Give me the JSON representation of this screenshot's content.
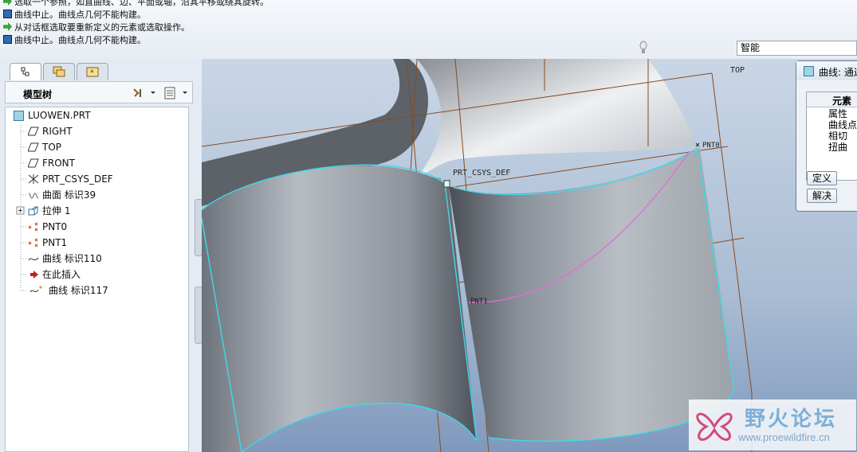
{
  "messages": [
    {
      "icon": "green-arrow-icon",
      "text": "选取一个参照，如直曲线、边、平面或轴，沿其平移或绕其旋转。"
    },
    {
      "icon": "warning-icon",
      "text": "曲线中止。曲线点几何不能构建。"
    },
    {
      "icon": "green-arrow-icon",
      "text": "从对话框选取要重新定义的元素或选取操作。"
    },
    {
      "icon": "warning-icon",
      "text": "曲线中止。曲线点几何不能构建。"
    }
  ],
  "filter": {
    "value": "智能"
  },
  "model_tree": {
    "title": "模型树",
    "items": [
      {
        "label": "LUOWEN.PRT",
        "icon": "part-icon"
      },
      {
        "label": "RIGHT",
        "icon": "datum-plane-icon"
      },
      {
        "label": "TOP",
        "icon": "datum-plane-icon"
      },
      {
        "label": "FRONT",
        "icon": "datum-plane-icon"
      },
      {
        "label": "PRT_CSYS_DEF",
        "icon": "csys-icon"
      },
      {
        "label": "曲面 标识39",
        "icon": "surface-icon"
      },
      {
        "label": "拉伸 1",
        "icon": "extrude-icon"
      },
      {
        "label": "PNT0",
        "icon": "datum-point-icon"
      },
      {
        "label": "PNT1",
        "icon": "datum-point-icon"
      },
      {
        "label": "曲线 标识110",
        "icon": "curve-icon"
      },
      {
        "label": "在此插入",
        "icon": "insert-here-icon"
      },
      {
        "label": "曲线 标识117",
        "icon": "curve-new-icon"
      }
    ]
  },
  "viewport": {
    "labels": {
      "top": "TOP",
      "csys": "PRT_CSYS_DEF",
      "pnt0": "PNT0",
      "pnt1": "PNT1"
    }
  },
  "dialog": {
    "title": "曲线: 通过",
    "column_header": "元素",
    "elements": [
      "属性",
      "曲线点",
      "相切",
      "扭曲"
    ],
    "define_button": "定义",
    "explain_button": "解决"
  },
  "watermark": {
    "title": "野火论坛",
    "url": "www.proewildfire.cn"
  },
  "colors": {
    "accent_datum": "#8a4a1e",
    "edge_highlight": "#3fd8e8",
    "curve": "#e070d0"
  }
}
